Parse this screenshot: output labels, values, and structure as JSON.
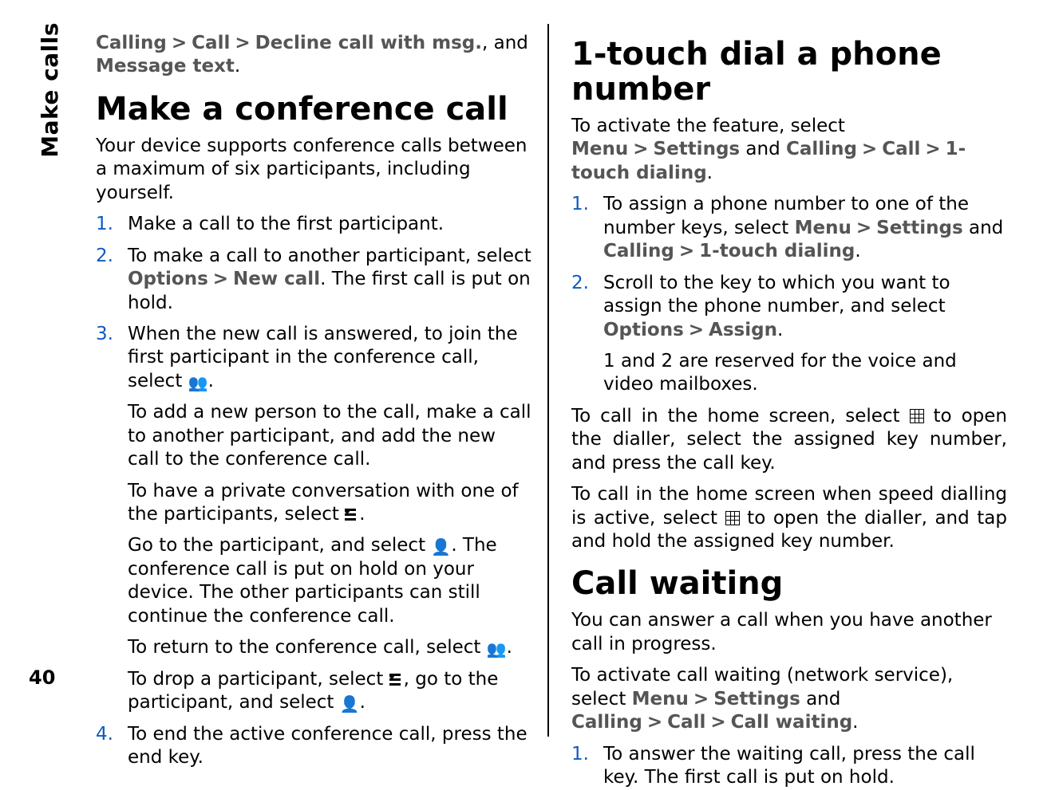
{
  "chrome": {
    "section_tab": "Make calls",
    "page_number": "40"
  },
  "intro_path": {
    "breadcrumb": [
      "Calling",
      "Call",
      "Decline call with msg."
    ],
    "tail_and": ", and ",
    "tail_item": "Message text",
    "period": "."
  },
  "conference": {
    "heading": "Make a conference call",
    "lead": "Your device supports conference calls between a maximum of six participants, including yourself.",
    "steps": {
      "s1": "Make a call to the first participant.",
      "s2_a": "To make a call to another participant, select ",
      "s2_opt": "Options",
      "s2_new": "New call",
      "s2_b": ". The first call is put on hold.",
      "s3_a": "When the new call is answered, to join the first participant in the conference call, select ",
      "s3_period": ".",
      "s3_sub1": "To add a new person to the call, make a call to another participant, and add the new call to the conference call.",
      "s3_sub2": "To have a private conversation with one of the participants, select ",
      "s3_sub3_a": "Go to the participant, and select ",
      "s3_sub3_b": ". The conference call is put on hold on your device. The other participants can still continue the conference call.",
      "s3_sub4": "To return to the conference call, select ",
      "s3_sub5_a": "To drop a participant, select ",
      "s3_sub5_b": ", go to the participant, and select ",
      "s4": "To end the active conference call, press the end key."
    }
  },
  "onetouch": {
    "heading": "1-touch dial a phone number",
    "lead_a": "To activate the feature, select ",
    "lead_menu": "Menu",
    "lead_settings": "Settings",
    "lead_and": " and ",
    "lead_path": [
      "Calling",
      "Call",
      "1-touch dialing"
    ],
    "lead_period": ".",
    "steps": {
      "s1_a": "To assign a phone number to one of the number keys, select ",
      "s1_menu": "Menu",
      "s1_settings": "Settings",
      "s1_and": " and ",
      "s1_path_a": "Calling",
      "s1_path_b": "1-touch dialing",
      "s1_period": ".",
      "s2_a": "Scroll to the key to which you want to assign the phone number, and select ",
      "s2_opt": "Options",
      "s2_assign": "Assign",
      "s2_period": ".",
      "s2_sub": "1 and 2 are reserved for the voice and video mailboxes."
    },
    "p3_a": "To call in the home screen, select ",
    "p3_b": " to open the dialler, select the assigned key number, and press the call key.",
    "p4_a": "To call in the home screen when speed dialling is active, select ",
    "p4_b": " to open the dialler, and tap and hold the assigned key number."
  },
  "waiting": {
    "heading": "Call waiting",
    "lead": "You can answer a call when you have another call in progress.",
    "p2_a": "To activate call waiting (network service), select ",
    "p2_menu": "Menu",
    "p2_settings": "Settings",
    "p2_and": " and ",
    "p2_path": [
      "Calling",
      "Call",
      "Call waiting"
    ],
    "p2_period": ".",
    "steps": {
      "s1": "To answer the waiting call, press the call key. The first call is put on hold."
    }
  },
  "glyphs": {
    "gt": ">"
  }
}
